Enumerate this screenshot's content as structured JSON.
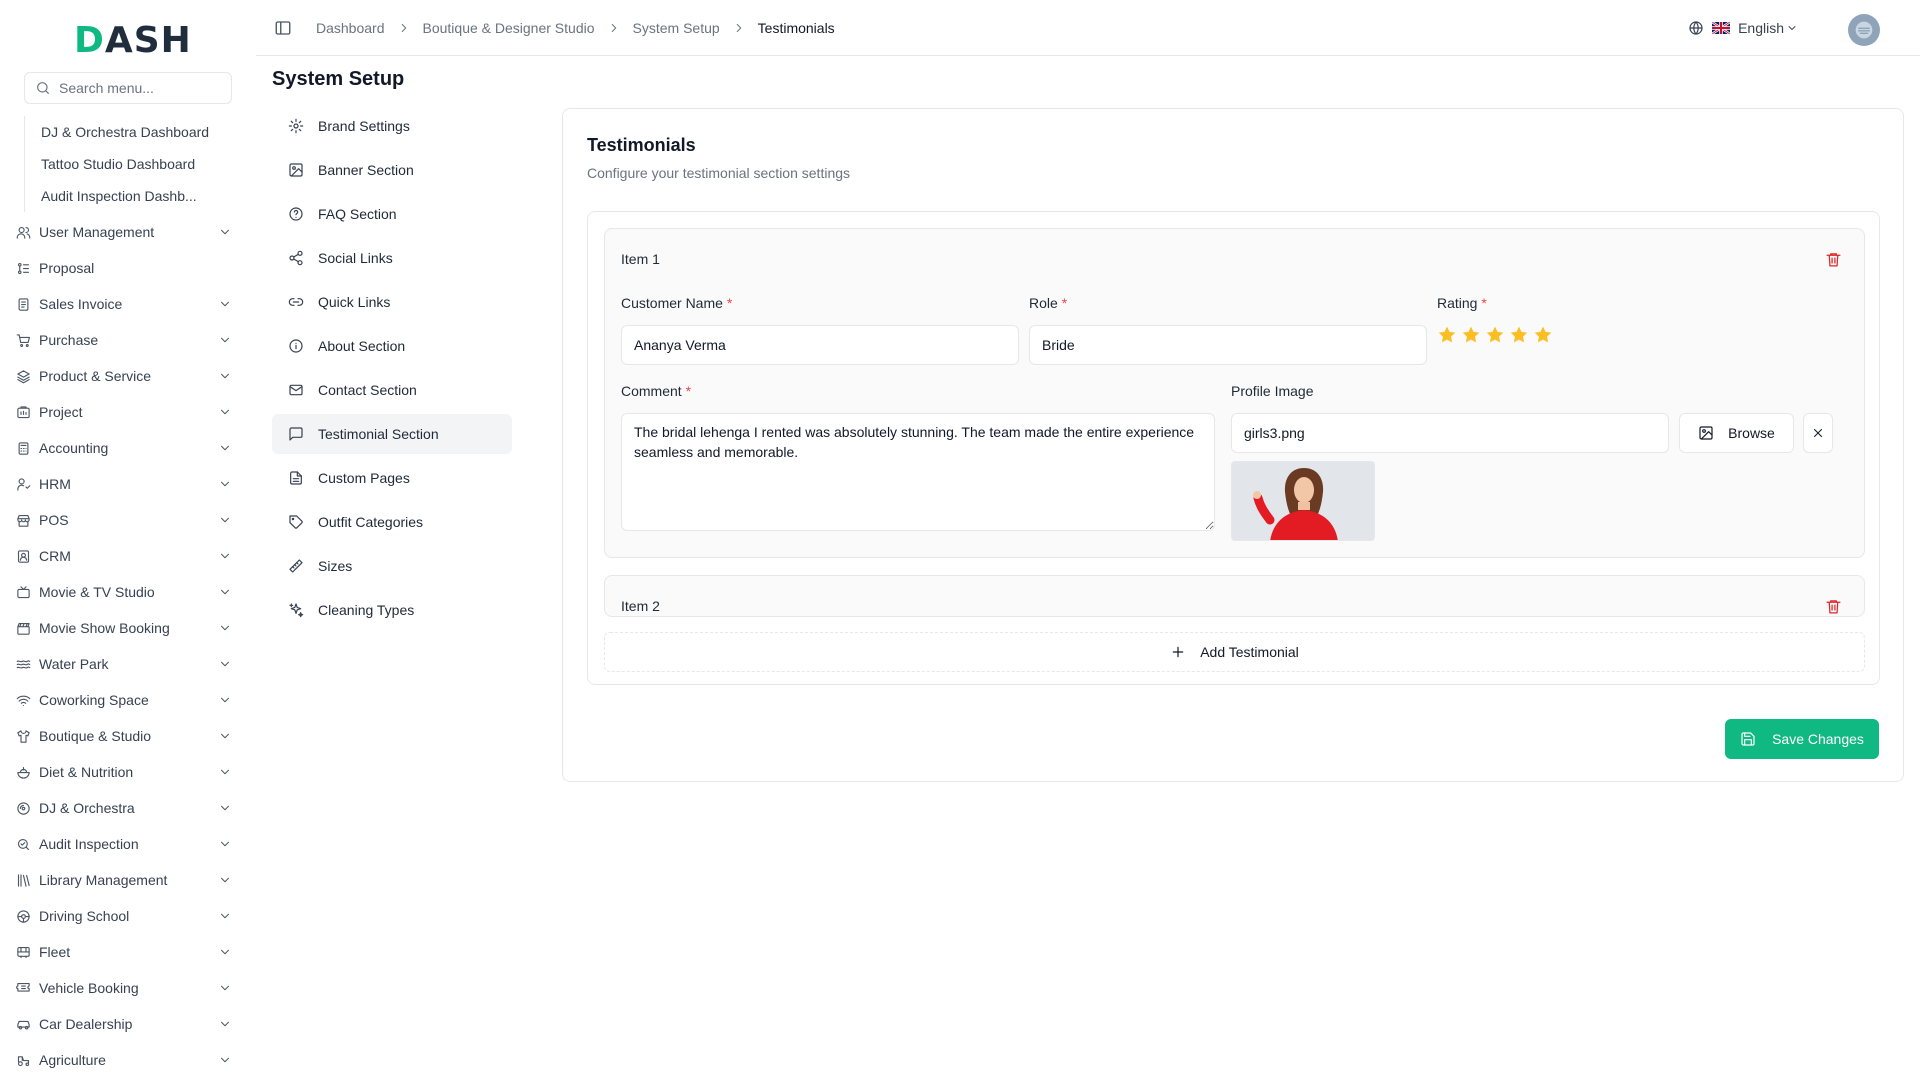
{
  "brand": {
    "logo_prefix": "D",
    "logo_rest": "ASH",
    "accent": "#10b981"
  },
  "sidebar": {
    "search_placeholder": "Search menu...",
    "sub_items": [
      {
        "label": "DJ & Orchestra Dashboard"
      },
      {
        "label": "Tattoo Studio Dashboard"
      },
      {
        "label": "Audit Inspection Dashb..."
      }
    ],
    "items": [
      {
        "label": "User Management",
        "icon": "users-icon",
        "chevron": true
      },
      {
        "label": "Proposal",
        "icon": "proposal-icon",
        "chevron": false
      },
      {
        "label": "Sales Invoice",
        "icon": "invoice-icon",
        "chevron": true
      },
      {
        "label": "Purchase",
        "icon": "cart-icon",
        "chevron": true
      },
      {
        "label": "Product & Service",
        "icon": "layers-icon",
        "chevron": true
      },
      {
        "label": "Project",
        "icon": "project-icon",
        "chevron": true
      },
      {
        "label": "Accounting",
        "icon": "calculator-icon",
        "chevron": true
      },
      {
        "label": "HRM",
        "icon": "hrm-icon",
        "chevron": true
      },
      {
        "label": "POS",
        "icon": "store-icon",
        "chevron": true
      },
      {
        "label": "CRM",
        "icon": "crm-icon",
        "chevron": true
      },
      {
        "label": "Movie & TV Studio",
        "icon": "tv-icon",
        "chevron": true
      },
      {
        "label": "Movie Show Booking",
        "icon": "clapper-icon",
        "chevron": true
      },
      {
        "label": "Water Park",
        "icon": "waves-icon",
        "chevron": true
      },
      {
        "label": "Coworking Space",
        "icon": "wifi-icon",
        "chevron": true
      },
      {
        "label": "Boutique & Studio",
        "icon": "shirt-icon",
        "chevron": true
      },
      {
        "label": "Diet & Nutrition",
        "icon": "salad-icon",
        "chevron": true
      },
      {
        "label": "DJ & Orchestra",
        "icon": "disc-icon",
        "chevron": true
      },
      {
        "label": "Audit Inspection",
        "icon": "search-check-icon",
        "chevron": true
      },
      {
        "label": "Library Management",
        "icon": "library-icon",
        "chevron": true
      },
      {
        "label": "Driving School",
        "icon": "steering-icon",
        "chevron": true
      },
      {
        "label": "Fleet",
        "icon": "bus-icon",
        "chevron": true
      },
      {
        "label": "Vehicle Booking",
        "icon": "ticket-icon",
        "chevron": true
      },
      {
        "label": "Car Dealership",
        "icon": "car-icon",
        "chevron": true
      },
      {
        "label": "Agriculture",
        "icon": "tractor-icon",
        "chevron": true
      }
    ]
  },
  "header": {
    "breadcrumbs": [
      "Dashboard",
      "Boutique & Designer Studio",
      "System Setup",
      "Testimonials"
    ],
    "language": "English"
  },
  "page": {
    "title": "System Setup"
  },
  "setup_nav": [
    {
      "label": "Brand Settings",
      "icon": "gear-icon",
      "active": false
    },
    {
      "label": "Banner Section",
      "icon": "image-icon",
      "active": false
    },
    {
      "label": "FAQ Section",
      "icon": "help-circle-icon",
      "active": false
    },
    {
      "label": "Social Links",
      "icon": "share-icon",
      "active": false
    },
    {
      "label": "Quick Links",
      "icon": "link-icon",
      "active": false
    },
    {
      "label": "About Section",
      "icon": "info-icon",
      "active": false
    },
    {
      "label": "Contact Section",
      "icon": "mail-icon",
      "active": false
    },
    {
      "label": "Testimonial Section",
      "icon": "message-square-icon",
      "active": true
    },
    {
      "label": "Custom Pages",
      "icon": "file-text-icon",
      "active": false
    },
    {
      "label": "Outfit Categories",
      "icon": "tag-icon",
      "active": false
    },
    {
      "label": "Sizes",
      "icon": "ruler-icon",
      "active": false
    },
    {
      "label": "Cleaning Types",
      "icon": "sparkles-icon",
      "active": false
    }
  ],
  "testimonials": {
    "title": "Testimonials",
    "subtitle": "Configure your testimonial section settings",
    "labels": {
      "customer_name": "Customer Name",
      "role": "Role",
      "rating": "Rating",
      "comment": "Comment",
      "profile_image": "Profile Image",
      "required_mark": "*"
    },
    "items": [
      {
        "heading": "Item 1",
        "customer_name": "Ananya Verma",
        "role": "Bride",
        "rating": 5,
        "rating_max": 5,
        "comment": "The bridal lehenga I rented was absolutely stunning. The team made the entire experience seamless and memorable.",
        "profile_image_file": "girls3.png"
      },
      {
        "heading": "Item 2"
      }
    ],
    "browse_label": "Browse",
    "add_label": "Add Testimonial",
    "save_label": "Save Changes",
    "star_color": "#fbbf24",
    "delete_color": "#dc2626"
  }
}
